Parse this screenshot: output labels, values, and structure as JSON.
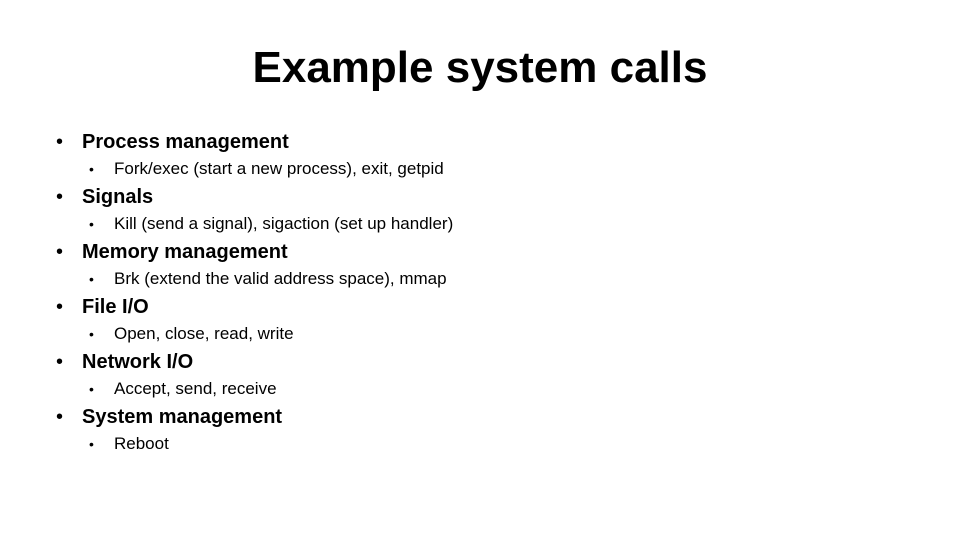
{
  "slide": {
    "title": "Example system calls",
    "bullet_glyph": "•",
    "items": [
      {
        "label": "Process management",
        "sub": [
          "Fork/exec (start a new process), exit, getpid"
        ]
      },
      {
        "label": "Signals",
        "sub": [
          "Kill (send a signal), sigaction (set up handler)"
        ]
      },
      {
        "label": "Memory management",
        "sub": [
          "Brk (extend the valid address space), mmap"
        ]
      },
      {
        "label": "File I/O",
        "sub": [
          "Open, close, read, write"
        ]
      },
      {
        "label": "Network I/O",
        "sub": [
          "Accept, send, receive"
        ]
      },
      {
        "label": "System management",
        "sub": [
          "Reboot"
        ]
      }
    ]
  }
}
